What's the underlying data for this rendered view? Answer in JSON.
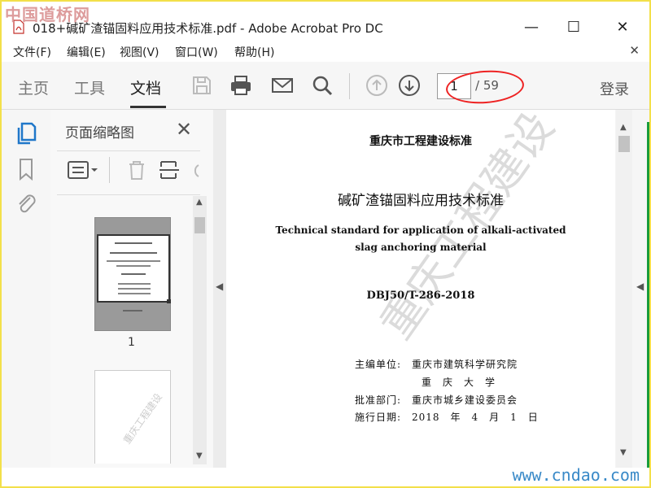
{
  "watermark_top": "中国道桥网",
  "window": {
    "title": "018+碱矿渣锚固料应用技术标准.pdf - Adobe Acrobat Pro DC",
    "minimize": "—",
    "maximize": "☐",
    "close": "✕"
  },
  "menu": {
    "items": [
      "文件(F)",
      "编辑(E)",
      "视图(V)",
      "窗口(W)",
      "帮助(H)"
    ],
    "close": "✕"
  },
  "toolbar": {
    "tabs": [
      "主页",
      "工具",
      "文档"
    ],
    "active_tab": "文档",
    "page_current": "1",
    "page_total": "/ 59",
    "login": "登录"
  },
  "thumb_panel": {
    "title": "页面缩略图",
    "close": "✕",
    "thumb_label": "1"
  },
  "document": {
    "org": "重庆市工程建设标准",
    "title_cn": "碱矿渣锚固料应用技术标准",
    "title_en_1": "Technical standard for application of alkali-activated",
    "title_en_2": "slag anchoring material",
    "code": "DBJ50/T-286-2018",
    "editor_label": "主编单位:",
    "editor_1": "重庆市建筑科学研究院",
    "editor_2": "重　庆　大　学",
    "approver_label": "批准部门:",
    "approver": "重庆市城乡建设委员会",
    "date_label": "施行日期:",
    "date": "2018　年　4　月　1　日",
    "watermark": "重庆工程建设"
  },
  "bottom_watermark": "www.cndao.com",
  "colors": {
    "accent_blue": "#1f77c9",
    "annotation_red": "#e22222",
    "frame_yellow": "#f3e04a"
  }
}
